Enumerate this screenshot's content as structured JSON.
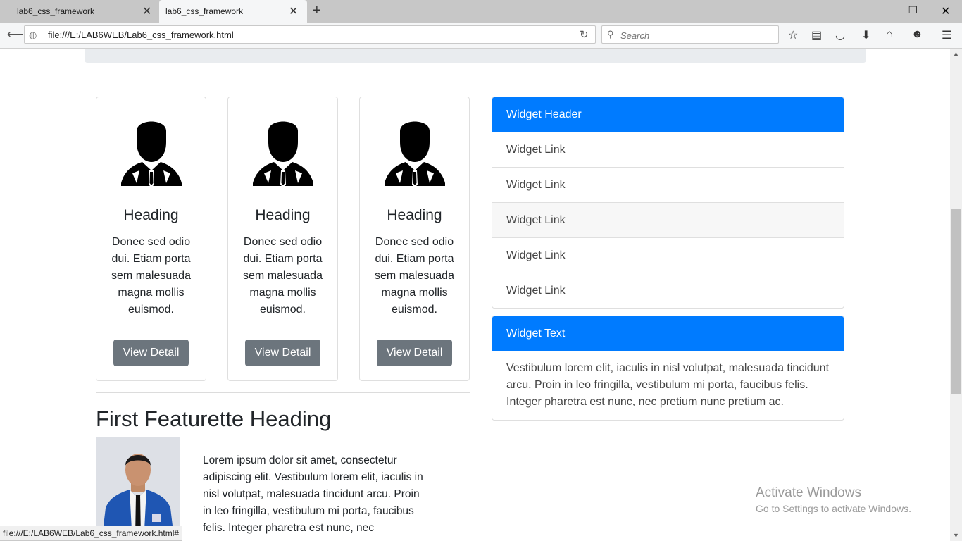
{
  "browser": {
    "tabs": [
      {
        "title": "lab6_css_framework",
        "active": false
      },
      {
        "title": "lab6_css_framework",
        "active": true
      }
    ],
    "url": "file:///E:/LAB6WEB/Lab6_css_framework.html",
    "search_placeholder": "Search",
    "status_url": "file:///E:/LAB6WEB/Lab6_css_framework.html#"
  },
  "cards": [
    {
      "heading": "Heading",
      "text": "Donec sed odio dui. Etiam porta sem malesuada magna mollis euismod.",
      "button": "View Detail"
    },
    {
      "heading": "Heading",
      "text": "Donec sed odio dui. Etiam porta sem malesuada magna mollis euismod.",
      "button": "View Detail"
    },
    {
      "heading": "Heading",
      "text": "Donec sed odio dui. Etiam porta sem malesuada magna mollis euismod.",
      "button": "View Detail"
    }
  ],
  "featurette": {
    "heading": "First Featurette Heading",
    "text": "Lorem ipsum dolor sit amet, consectetur adipiscing elit. Vestibulum lorem elit, iaculis in nisl volutpat, malesuada tincidunt arcu. Proin in leo fringilla, vestibulum mi porta, faucibus felis. Integer pharetra est nunc, nec"
  },
  "widget_links": {
    "header": "Widget Header",
    "links": [
      "Widget Link",
      "Widget Link",
      "Widget Link",
      "Widget Link",
      "Widget Link"
    ]
  },
  "widget_text": {
    "header": "Widget Text",
    "body": "Vestibulum lorem elit, iaculis in nisl volutpat, malesuada tincidunt arcu. Proin in leo fringilla, vestibulum mi porta, faucibus felis. Integer pharetra est nunc, nec pretium nunc pretium ac."
  },
  "activation": {
    "title": "Activate Windows",
    "subtitle": "Go to Settings to activate Windows."
  },
  "colors": {
    "primary": "#007bff",
    "secondary": "#6c757d",
    "jumbotron": "#e9ecef"
  }
}
